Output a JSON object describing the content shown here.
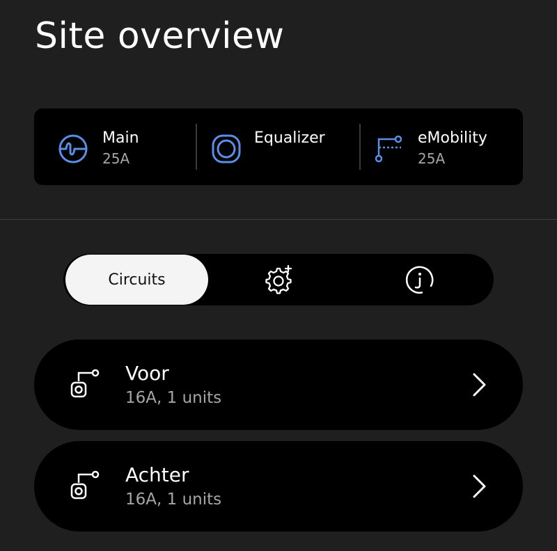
{
  "page": {
    "title": "Site overview"
  },
  "summary": {
    "main": {
      "label": "Main",
      "value": "25A",
      "icon": "waveform-circle-icon"
    },
    "equalizer": {
      "label": "Equalizer",
      "value": "",
      "icon": "equalizer-ring-icon"
    },
    "emobility": {
      "label": "eMobility",
      "value": "25A",
      "icon": "emobility-circuit-icon"
    }
  },
  "tabs": {
    "circuits_label": "Circuits",
    "settings_icon": "gear-plus-icon",
    "info_icon": "info-icon",
    "active": "Circuits"
  },
  "circuits": [
    {
      "name": "Voor",
      "detail": "16A, 1 units",
      "icon": "charger-circuit-icon"
    },
    {
      "name": "Achter",
      "detail": "16A, 1 units",
      "icon": "charger-circuit-icon"
    }
  ],
  "colors": {
    "background": "#1f1f1f",
    "card": "#000000",
    "accent_blue": "#5a8ee8",
    "muted_text": "#a6a6a6",
    "active_tab": "#f4f4f4"
  }
}
